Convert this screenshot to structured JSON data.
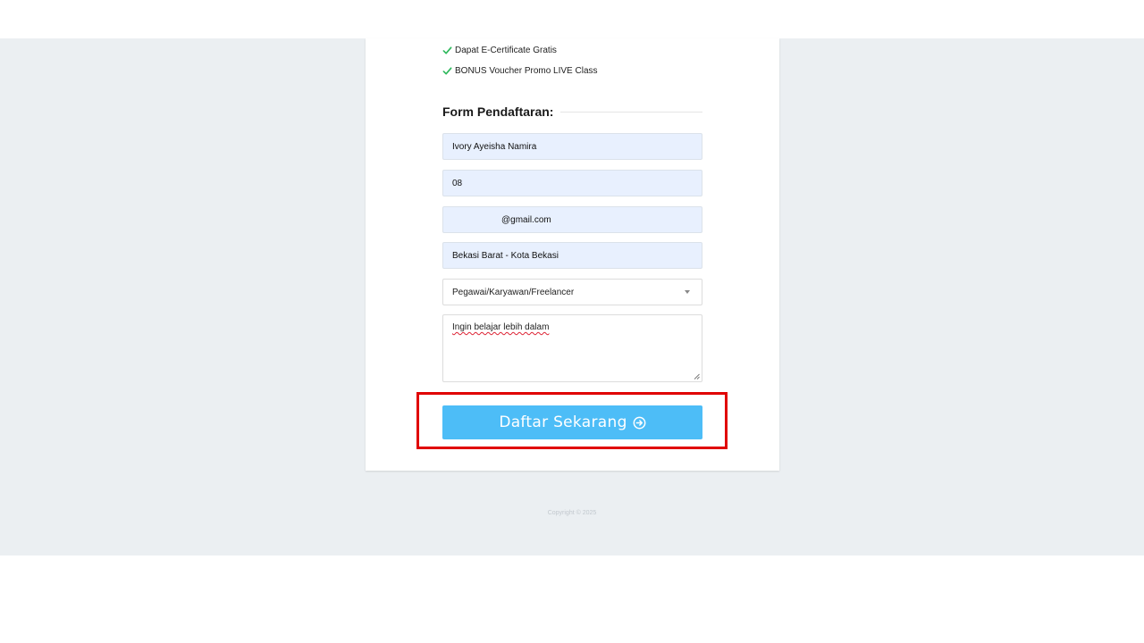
{
  "benefits": [
    {
      "label": "Dapat E-Certificate Gratis",
      "icon": "check-icon"
    },
    {
      "label": "BONUS Voucher Promo LIVE Class",
      "icon": "check-icon"
    }
  ],
  "form": {
    "heading": "Form Pendaftaran:",
    "name_value": "Ivory Ayeisha Namira",
    "phone_value": "08",
    "email_value": "@gmail.com",
    "location_value": "Bekasi Barat - Kota Bekasi",
    "occupation_selected": "Pegawai/Karyawan/Freelancer",
    "reason_value": "Ingin belajar lebih dalam",
    "submit_label": "Daftar Sekarang"
  },
  "footer": {
    "copyright": "Copyright © 2025"
  },
  "colors": {
    "accent": "#4dbdf7",
    "highlight": "#e00000",
    "check": "#2eb85c",
    "page_bg": "#ebeff2"
  }
}
